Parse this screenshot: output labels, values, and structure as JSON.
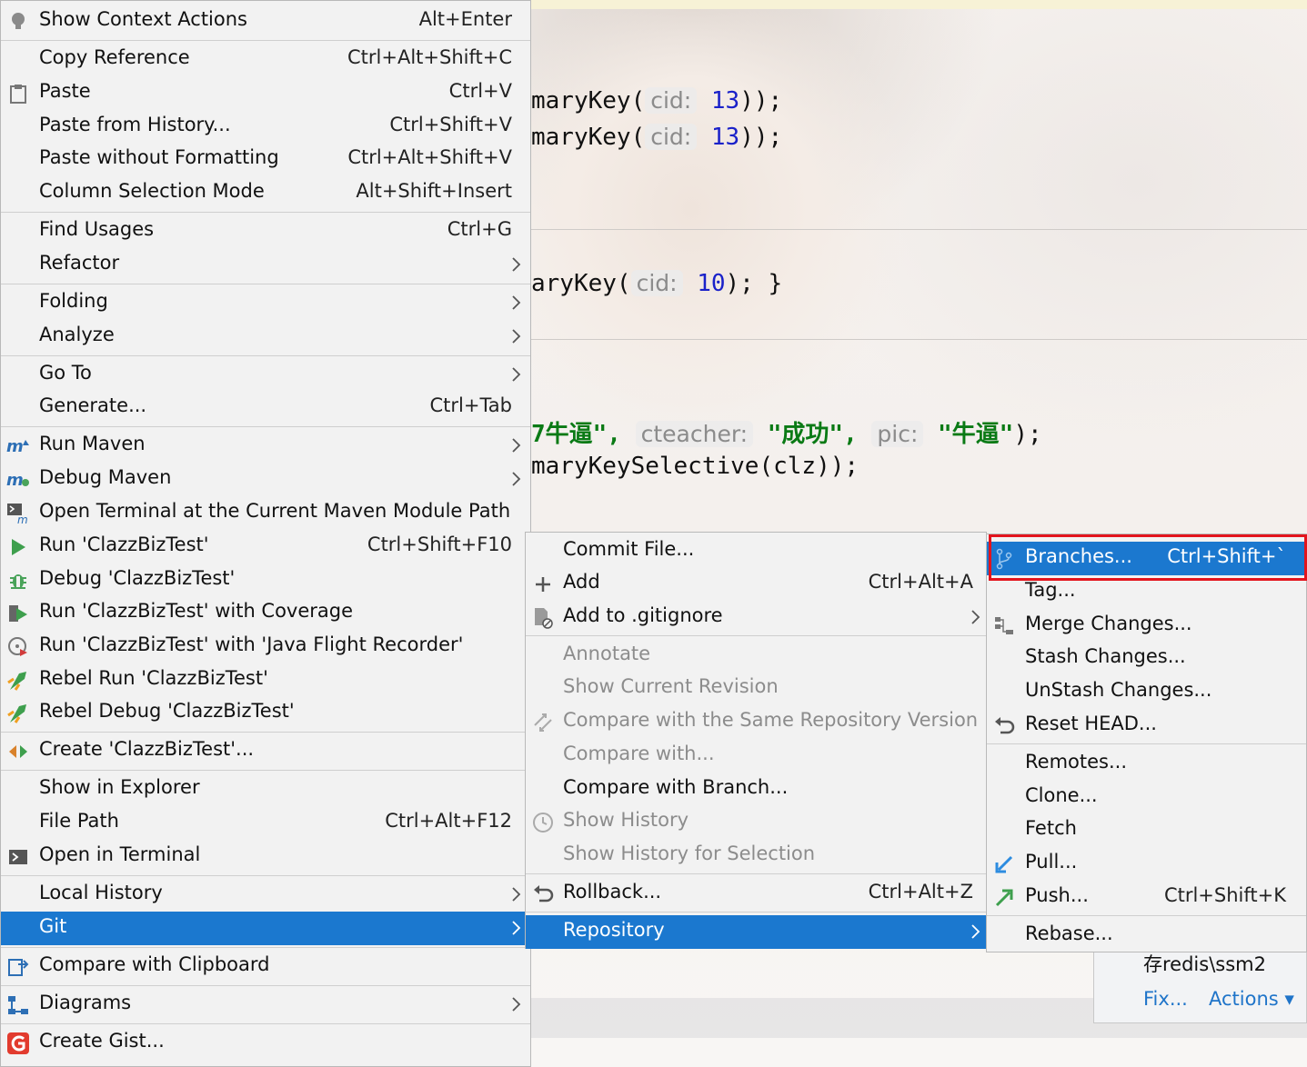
{
  "editor": {
    "lines": [
      {
        "pre": "maryKey(",
        "hint": "cid:",
        "val": "13",
        "post": "));"
      },
      {
        "pre": "maryKey(",
        "hint": "cid:",
        "val": "13",
        "post": "));"
      },
      {
        "pre": "aryKey(",
        "hint": "cid:",
        "val": "10",
        "post": "); }"
      }
    ],
    "insert_line": {
      "s1": "7牛逼\",",
      "h1": "cteacher:",
      "s2": "\"成功\",",
      "h2": "pic:",
      "s3": "\"牛逼\"",
      "end": ");"
    },
    "selective_line": "maryKeySelective(clz));"
  },
  "notification": {
    "path": "存redis\\ssm2",
    "fix": "Fix...",
    "actions": "Actions ▾"
  },
  "context_menu": {
    "items": [
      {
        "label": "Show Context Actions",
        "shortcut": "Alt+Enter",
        "icon": "lightbulb-icon"
      },
      {
        "label": "Copy Reference",
        "shortcut": "Ctrl+Alt+Shift+C"
      },
      {
        "label": "Paste",
        "shortcut": "Ctrl+V",
        "icon": "clipboard-icon"
      },
      {
        "label": "Paste from History...",
        "shortcut": "Ctrl+Shift+V"
      },
      {
        "label": "Paste without Formatting",
        "shortcut": "Ctrl+Alt+Shift+V"
      },
      {
        "label": "Column Selection Mode",
        "shortcut": "Alt+Shift+Insert"
      },
      {
        "label": "Find Usages",
        "shortcut": "Ctrl+G"
      },
      {
        "label": "Refactor"
      },
      {
        "label": "Folding"
      },
      {
        "label": "Analyze"
      },
      {
        "label": "Go To"
      },
      {
        "label": "Generate...",
        "shortcut": "Ctrl+Tab"
      },
      {
        "label": "Run Maven",
        "icon": "maven-run-icon"
      },
      {
        "label": "Debug Maven",
        "icon": "maven-debug-icon"
      },
      {
        "label": "Open Terminal at the Current Maven Module Path",
        "icon": "maven-terminal-icon"
      },
      {
        "label": "Run 'ClazzBizTest'",
        "shortcut": "Ctrl+Shift+F10",
        "icon": "run-icon"
      },
      {
        "label": "Debug 'ClazzBizTest'",
        "icon": "debug-icon"
      },
      {
        "label": "Run 'ClazzBizTest' with Coverage",
        "icon": "coverage-icon"
      },
      {
        "label": "Run 'ClazzBizTest' with 'Java Flight Recorder'",
        "icon": "flight-recorder-icon"
      },
      {
        "label": "Rebel Run 'ClazzBizTest'",
        "icon": "rebel-run-icon"
      },
      {
        "label": "Rebel Debug 'ClazzBizTest'",
        "icon": "rebel-debug-icon"
      },
      {
        "label": "Create 'ClazzBizTest'...",
        "icon": "create-config-icon"
      },
      {
        "label": "Show in Explorer"
      },
      {
        "label": "File Path",
        "shortcut": "Ctrl+Alt+F12"
      },
      {
        "label": "Open in Terminal",
        "icon": "terminal-icon"
      },
      {
        "label": "Local History"
      },
      {
        "label": "Git"
      },
      {
        "label": "Compare with Clipboard",
        "icon": "compare-clipboard-icon"
      },
      {
        "label": "Diagrams",
        "icon": "diagram-icon"
      },
      {
        "label": "Create Gist...",
        "icon": "gist-icon"
      }
    ]
  },
  "git_menu": {
    "items": [
      {
        "label": "Commit File..."
      },
      {
        "label": "Add",
        "shortcut": "Ctrl+Alt+A",
        "icon": "plus-icon"
      },
      {
        "label": "Add to .gitignore",
        "icon": "gitignore-icon"
      },
      {
        "label": "Annotate"
      },
      {
        "label": "Show Current Revision"
      },
      {
        "label": "Compare with the Same Repository Version",
        "icon": "compare-icon"
      },
      {
        "label": "Compare with..."
      },
      {
        "label": "Compare with Branch..."
      },
      {
        "label": "Show History",
        "icon": "history-icon"
      },
      {
        "label": "Show History for Selection"
      },
      {
        "label": "Rollback...",
        "shortcut": "Ctrl+Alt+Z",
        "icon": "rollback-icon"
      },
      {
        "label": "Repository"
      }
    ]
  },
  "repo_menu": {
    "items": [
      {
        "label": "Branches...",
        "shortcut": "Ctrl+Shift+`",
        "icon": "branch-icon"
      },
      {
        "label": "Tag..."
      },
      {
        "label": "Merge Changes...",
        "icon": "merge-icon"
      },
      {
        "label": "Stash Changes..."
      },
      {
        "label": "UnStash Changes..."
      },
      {
        "label": "Reset HEAD...",
        "icon": "reset-icon"
      },
      {
        "label": "Remotes..."
      },
      {
        "label": "Clone..."
      },
      {
        "label": "Fetch"
      },
      {
        "label": "Pull...",
        "icon": "pull-icon"
      },
      {
        "label": "Push...",
        "shortcut": "Ctrl+Shift+K",
        "icon": "push-icon"
      },
      {
        "label": "Rebase..."
      }
    ]
  },
  "colors": {
    "selection": "#1b78cf",
    "menu_bg": "#f2f2f2",
    "highlight_border": "#e3141d"
  }
}
